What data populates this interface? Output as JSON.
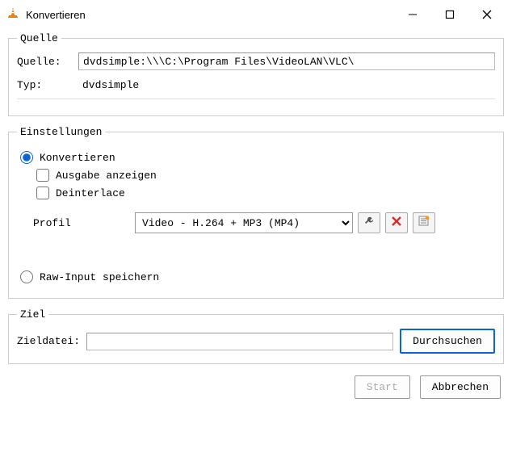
{
  "window": {
    "title": "Konvertieren"
  },
  "quelle": {
    "legend": "Quelle",
    "source_label": "Quelle:",
    "source_value": "dvdsimple:\\\\\\C:\\Program Files\\VideoLAN\\VLC\\",
    "type_label": "Typ:",
    "type_value": "dvdsimple"
  },
  "einstellungen": {
    "legend": "Einstellungen",
    "convert_label": "Konvertieren",
    "show_output_label": "Ausgabe anzeigen",
    "deinterlace_label": "Deinterlace",
    "profile_label": "Profil",
    "profile_selected": "Video - H.264 + MP3 (MP4)",
    "raw_input_label": "Raw-Input speichern"
  },
  "ziel": {
    "legend": "Ziel",
    "dest_label": "Zieldatei:",
    "dest_value": "",
    "browse_label": "Durchsuchen"
  },
  "buttons": {
    "start": "Start",
    "cancel": "Abbrechen"
  }
}
